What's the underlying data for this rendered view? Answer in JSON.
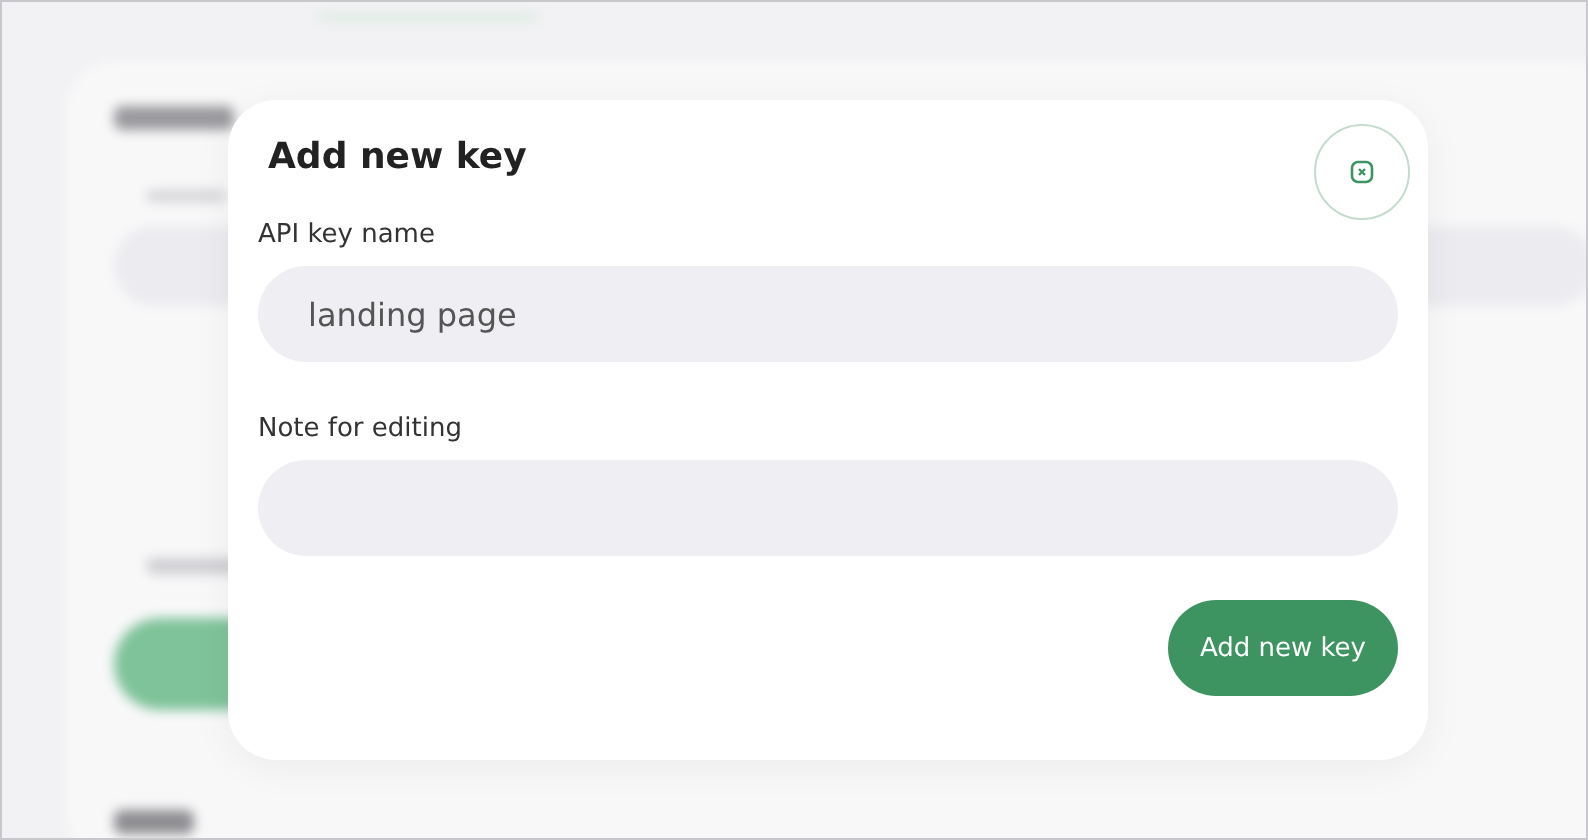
{
  "dialog": {
    "title": "Add new key",
    "fields": [
      {
        "label": "API key name",
        "value": "landing page"
      },
      {
        "label": "Note for editing"
      }
    ],
    "submit_button": "Add new key"
  }
}
